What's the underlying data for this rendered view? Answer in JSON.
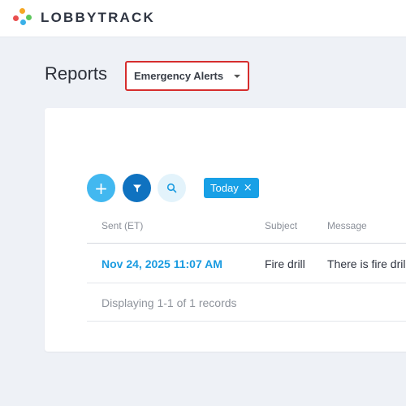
{
  "app": {
    "brand": "LOBBYTRACK",
    "logo_colors": [
      "#f5a623",
      "#e94e4e",
      "#3ab0e8",
      "#5cc75c"
    ]
  },
  "page": {
    "title": "Reports",
    "report_select": {
      "selected": "Emergency Alerts"
    }
  },
  "toolbar": {
    "add_icon": "plus-icon",
    "filter_icon": "filter-icon",
    "search_icon": "search-icon",
    "filter_chip": {
      "label": "Today",
      "remove": "×"
    }
  },
  "table": {
    "columns": [
      "Sent (ET)",
      "Subject",
      "Message"
    ],
    "rows": [
      {
        "sent": "Nov 24, 2025 11:07 AM",
        "subject": "Fire drill",
        "message": "There is fire drill"
      }
    ],
    "footer": "Displaying 1-1 of 1 records"
  },
  "colors": {
    "accent": "#1a9be0",
    "highlight_border": "#d62d2d",
    "primary_button": "#0f72c0"
  }
}
